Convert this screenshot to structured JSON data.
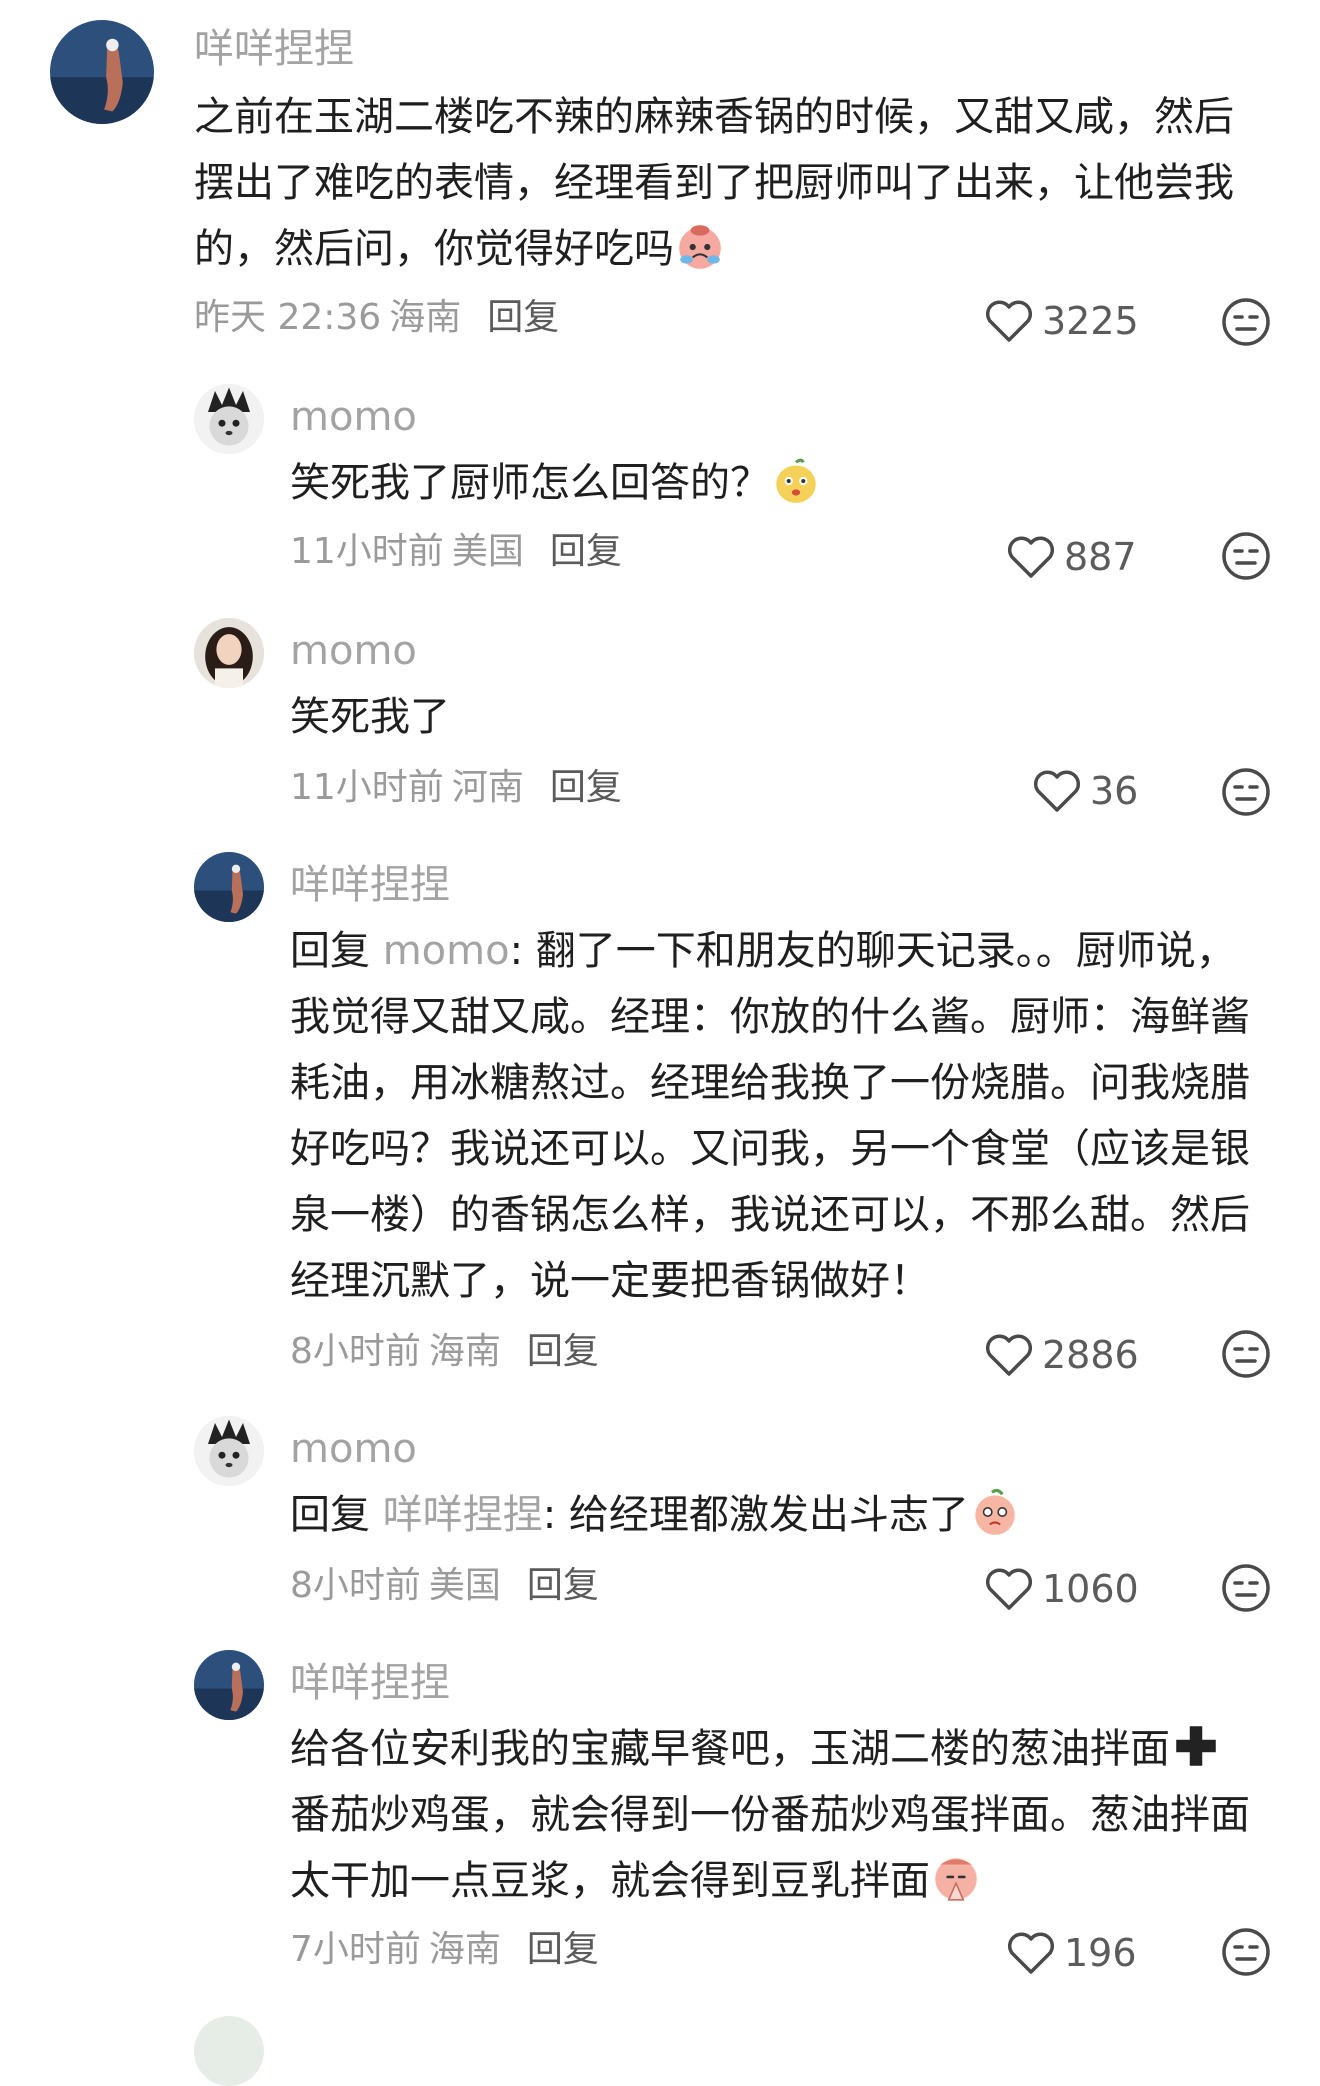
{
  "comments": [
    {
      "username": "咩咩捏捏",
      "text": "之前在玉湖二楼吃不辣的麻辣香锅的时候，又甜又咸，然后摆出了难吃的表情，经理看到了把厨师叫了出来，让他尝我的，然后问，你觉得好吃吗",
      "time": "昨天 22:36",
      "region": "海南",
      "reply_label": "回复",
      "likes": "3225",
      "avatar_icon": "avatar-cartoon-icon",
      "emoji_icon": "crying-face-emoji-icon"
    },
    {
      "username": "momo",
      "text": "笑死我了厨师怎么回答的？",
      "time": "11小时前",
      "region": "美国",
      "reply_label": "回复",
      "likes": "887",
      "avatar_icon": "avatar-cat-icon",
      "emoji_icon": "pear-face-emoji-icon"
    },
    {
      "username": "momo",
      "text": "笑死我了",
      "time": "11小时前",
      "region": "河南",
      "reply_label": "回复",
      "likes": "36",
      "avatar_icon": "avatar-woman-icon"
    },
    {
      "username": "咩咩捏捏",
      "reply_prefix": "回复",
      "reply_target": "momo",
      "text": ": 翻了一下和朋友的聊天记录。。厨师说，我觉得又甜又咸。经理：你放的什么酱。厨师：海鲜酱耗油，用冰糖熬过。经理给我换了一份烧腊。问我烧腊好吃吗？我说还可以。又问我，另一个食堂（应该是银泉一楼）的香锅怎么样，我说还可以，不那么甜。然后经理沉默了，说一定要把香锅做好！",
      "time": "8小时前",
      "region": "海南",
      "reply_label": "回复",
      "likes": "2886",
      "avatar_icon": "avatar-cartoon-icon"
    },
    {
      "username": "momo",
      "reply_prefix": "回复",
      "reply_target": "咩咩捏捏",
      "text": ": 给经理都激发出斗志了",
      "time": "8小时前",
      "region": "美国",
      "reply_label": "回复",
      "likes": "1060",
      "avatar_icon": "avatar-cat-icon",
      "emoji_icon": "peach-face-emoji-icon"
    },
    {
      "username": "咩咩捏捏",
      "text_part1": "给各位安利我的宝藏早餐吧，玉湖二楼的葱油拌面",
      "text_part2": "番茄炒鸡蛋，就会得到一份番茄炒鸡蛋拌面。葱油拌面太干加一点豆浆，就会得到豆乳拌面",
      "time": "7小时前",
      "region": "海南",
      "reply_label": "回复",
      "likes": "196",
      "avatar_icon": "avatar-cartoon-icon",
      "emoji_icon": "pray-face-emoji-icon",
      "plus_icon": "plus-emoji-icon"
    }
  ],
  "colors": {
    "username": "#a3a3a3",
    "text": "#1f1f1f",
    "meta": "#9a9a9a"
  }
}
